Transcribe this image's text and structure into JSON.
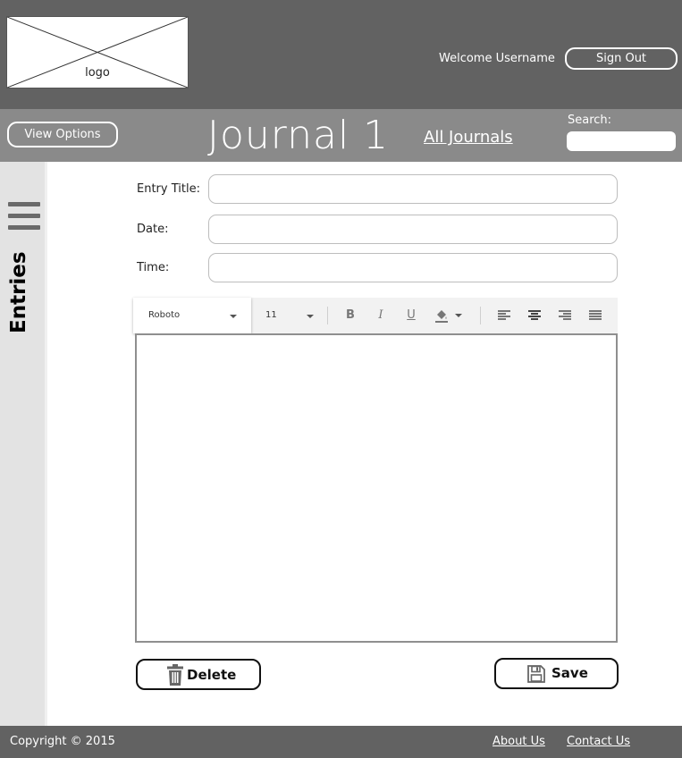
{
  "header": {
    "logo_label": "logo",
    "welcome_text": "Welcome Username",
    "signout_label": "Sign Out"
  },
  "subbar": {
    "view_options_label": "View Options",
    "journal_title": "Journal 1",
    "all_journals_label": "All Journals",
    "search_label": "Search:"
  },
  "sidebar": {
    "entries_label": "Entries"
  },
  "form": {
    "entry_title_label": "Entry Title:",
    "date_label": "Date:",
    "time_label": "Time:"
  },
  "toolbar": {
    "font_value": "Roboto",
    "size_value": "11",
    "bold_glyph": "B",
    "italic_glyph": "I",
    "underline_glyph": "U"
  },
  "actions": {
    "delete_label": "Delete",
    "save_label": "Save"
  },
  "footer": {
    "copyright": "Copyright © 2015",
    "about_label": "About Us",
    "contact_label": "Contact Us"
  },
  "colors": {
    "header_bg": "#626262",
    "subbar_bg": "#8a8a8a",
    "sidebar_bg": "#e3e3e3"
  }
}
